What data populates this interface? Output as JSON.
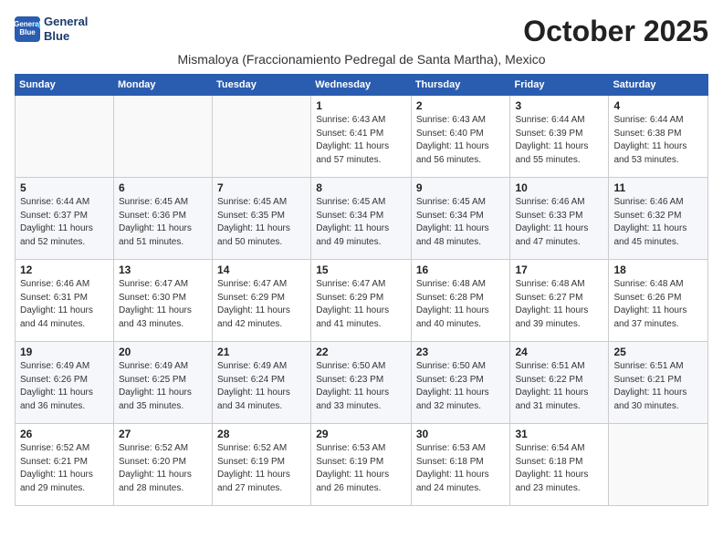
{
  "logo": {
    "line1": "General",
    "line2": "Blue"
  },
  "header": {
    "month_title": "October 2025",
    "subtitle": "Mismaloya (Fraccionamiento Pedregal de Santa Martha), Mexico"
  },
  "weekdays": [
    "Sunday",
    "Monday",
    "Tuesday",
    "Wednesday",
    "Thursday",
    "Friday",
    "Saturday"
  ],
  "weeks": [
    [
      {
        "day": "",
        "info": ""
      },
      {
        "day": "",
        "info": ""
      },
      {
        "day": "",
        "info": ""
      },
      {
        "day": "1",
        "info": "Sunrise: 6:43 AM\nSunset: 6:41 PM\nDaylight: 11 hours and 57 minutes."
      },
      {
        "day": "2",
        "info": "Sunrise: 6:43 AM\nSunset: 6:40 PM\nDaylight: 11 hours and 56 minutes."
      },
      {
        "day": "3",
        "info": "Sunrise: 6:44 AM\nSunset: 6:39 PM\nDaylight: 11 hours and 55 minutes."
      },
      {
        "day": "4",
        "info": "Sunrise: 6:44 AM\nSunset: 6:38 PM\nDaylight: 11 hours and 53 minutes."
      }
    ],
    [
      {
        "day": "5",
        "info": "Sunrise: 6:44 AM\nSunset: 6:37 PM\nDaylight: 11 hours and 52 minutes."
      },
      {
        "day": "6",
        "info": "Sunrise: 6:45 AM\nSunset: 6:36 PM\nDaylight: 11 hours and 51 minutes."
      },
      {
        "day": "7",
        "info": "Sunrise: 6:45 AM\nSunset: 6:35 PM\nDaylight: 11 hours and 50 minutes."
      },
      {
        "day": "8",
        "info": "Sunrise: 6:45 AM\nSunset: 6:34 PM\nDaylight: 11 hours and 49 minutes."
      },
      {
        "day": "9",
        "info": "Sunrise: 6:45 AM\nSunset: 6:34 PM\nDaylight: 11 hours and 48 minutes."
      },
      {
        "day": "10",
        "info": "Sunrise: 6:46 AM\nSunset: 6:33 PM\nDaylight: 11 hours and 47 minutes."
      },
      {
        "day": "11",
        "info": "Sunrise: 6:46 AM\nSunset: 6:32 PM\nDaylight: 11 hours and 45 minutes."
      }
    ],
    [
      {
        "day": "12",
        "info": "Sunrise: 6:46 AM\nSunset: 6:31 PM\nDaylight: 11 hours and 44 minutes."
      },
      {
        "day": "13",
        "info": "Sunrise: 6:47 AM\nSunset: 6:30 PM\nDaylight: 11 hours and 43 minutes."
      },
      {
        "day": "14",
        "info": "Sunrise: 6:47 AM\nSunset: 6:29 PM\nDaylight: 11 hours and 42 minutes."
      },
      {
        "day": "15",
        "info": "Sunrise: 6:47 AM\nSunset: 6:29 PM\nDaylight: 11 hours and 41 minutes."
      },
      {
        "day": "16",
        "info": "Sunrise: 6:48 AM\nSunset: 6:28 PM\nDaylight: 11 hours and 40 minutes."
      },
      {
        "day": "17",
        "info": "Sunrise: 6:48 AM\nSunset: 6:27 PM\nDaylight: 11 hours and 39 minutes."
      },
      {
        "day": "18",
        "info": "Sunrise: 6:48 AM\nSunset: 6:26 PM\nDaylight: 11 hours and 37 minutes."
      }
    ],
    [
      {
        "day": "19",
        "info": "Sunrise: 6:49 AM\nSunset: 6:26 PM\nDaylight: 11 hours and 36 minutes."
      },
      {
        "day": "20",
        "info": "Sunrise: 6:49 AM\nSunset: 6:25 PM\nDaylight: 11 hours and 35 minutes."
      },
      {
        "day": "21",
        "info": "Sunrise: 6:49 AM\nSunset: 6:24 PM\nDaylight: 11 hours and 34 minutes."
      },
      {
        "day": "22",
        "info": "Sunrise: 6:50 AM\nSunset: 6:23 PM\nDaylight: 11 hours and 33 minutes."
      },
      {
        "day": "23",
        "info": "Sunrise: 6:50 AM\nSunset: 6:23 PM\nDaylight: 11 hours and 32 minutes."
      },
      {
        "day": "24",
        "info": "Sunrise: 6:51 AM\nSunset: 6:22 PM\nDaylight: 11 hours and 31 minutes."
      },
      {
        "day": "25",
        "info": "Sunrise: 6:51 AM\nSunset: 6:21 PM\nDaylight: 11 hours and 30 minutes."
      }
    ],
    [
      {
        "day": "26",
        "info": "Sunrise: 6:52 AM\nSunset: 6:21 PM\nDaylight: 11 hours and 29 minutes."
      },
      {
        "day": "27",
        "info": "Sunrise: 6:52 AM\nSunset: 6:20 PM\nDaylight: 11 hours and 28 minutes."
      },
      {
        "day": "28",
        "info": "Sunrise: 6:52 AM\nSunset: 6:19 PM\nDaylight: 11 hours and 27 minutes."
      },
      {
        "day": "29",
        "info": "Sunrise: 6:53 AM\nSunset: 6:19 PM\nDaylight: 11 hours and 26 minutes."
      },
      {
        "day": "30",
        "info": "Sunrise: 6:53 AM\nSunset: 6:18 PM\nDaylight: 11 hours and 24 minutes."
      },
      {
        "day": "31",
        "info": "Sunrise: 6:54 AM\nSunset: 6:18 PM\nDaylight: 11 hours and 23 minutes."
      },
      {
        "day": "",
        "info": ""
      }
    ]
  ]
}
